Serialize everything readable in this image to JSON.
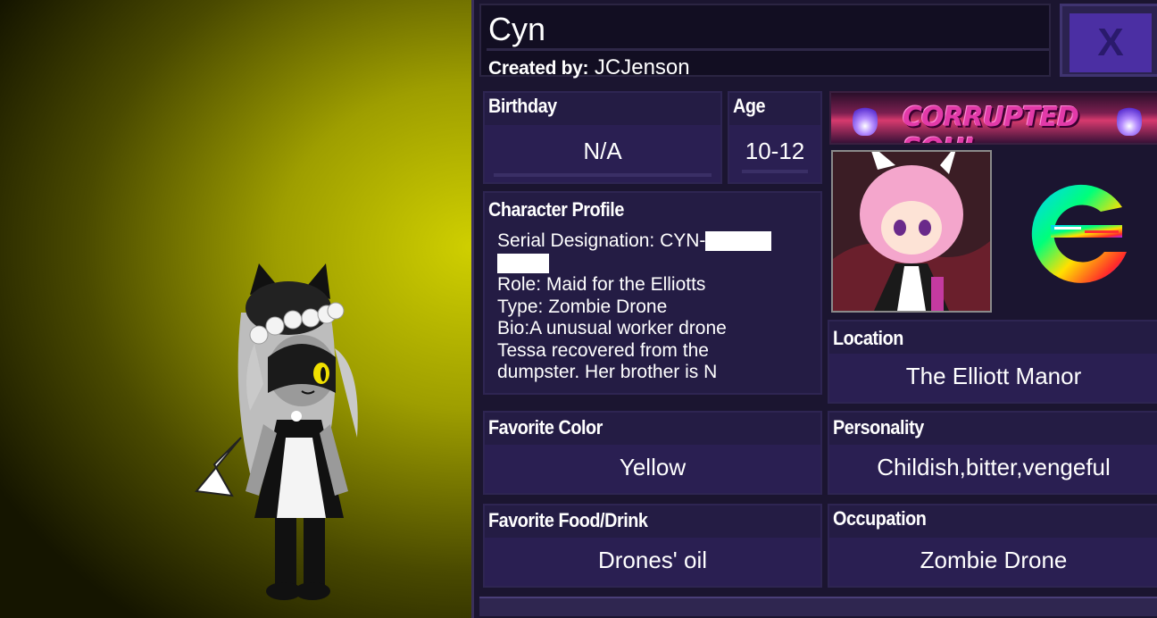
{
  "character": {
    "name": "Cyn",
    "created_by_label": "Created by:",
    "creator": "JCJenson"
  },
  "close_button": {
    "label": "X"
  },
  "fields": {
    "birthday": {
      "label": "Birthday",
      "value": "N/A"
    },
    "age": {
      "label": "Age",
      "value": "10-12"
    },
    "profile": {
      "label": "Character Profile",
      "lines": [
        "Serial Designation: CYN-",
        "Role: Maid for the Elliotts",
        "Type: Zombie Drone",
        "Bio:A unusual worker drone",
        "Tessa recovered from the",
        "dumpster. Her brother is N"
      ]
    },
    "location": {
      "label": "Location",
      "value": "The Elliott Manor"
    },
    "favorite_color": {
      "label": "Favorite Color",
      "value": "Yellow"
    },
    "personality": {
      "label": "Personality",
      "value": "Childish,bitter,vengeful"
    },
    "favorite_food": {
      "label": "Favorite Food/Drink",
      "value": "Drones' oil"
    },
    "occupation": {
      "label": "Occupation",
      "value": "Zombie Drone"
    }
  },
  "banner": {
    "text": "CORRUPTED SOUL"
  },
  "icons": [
    "close-icon",
    "flame-icon",
    "avatar-image",
    "logo-icon",
    "character-figure"
  ],
  "colors": {
    "panel": "#1b1530",
    "field_value": "#2a1f52",
    "close_button": "#4b2fa3",
    "stage": "#cfcf00"
  }
}
